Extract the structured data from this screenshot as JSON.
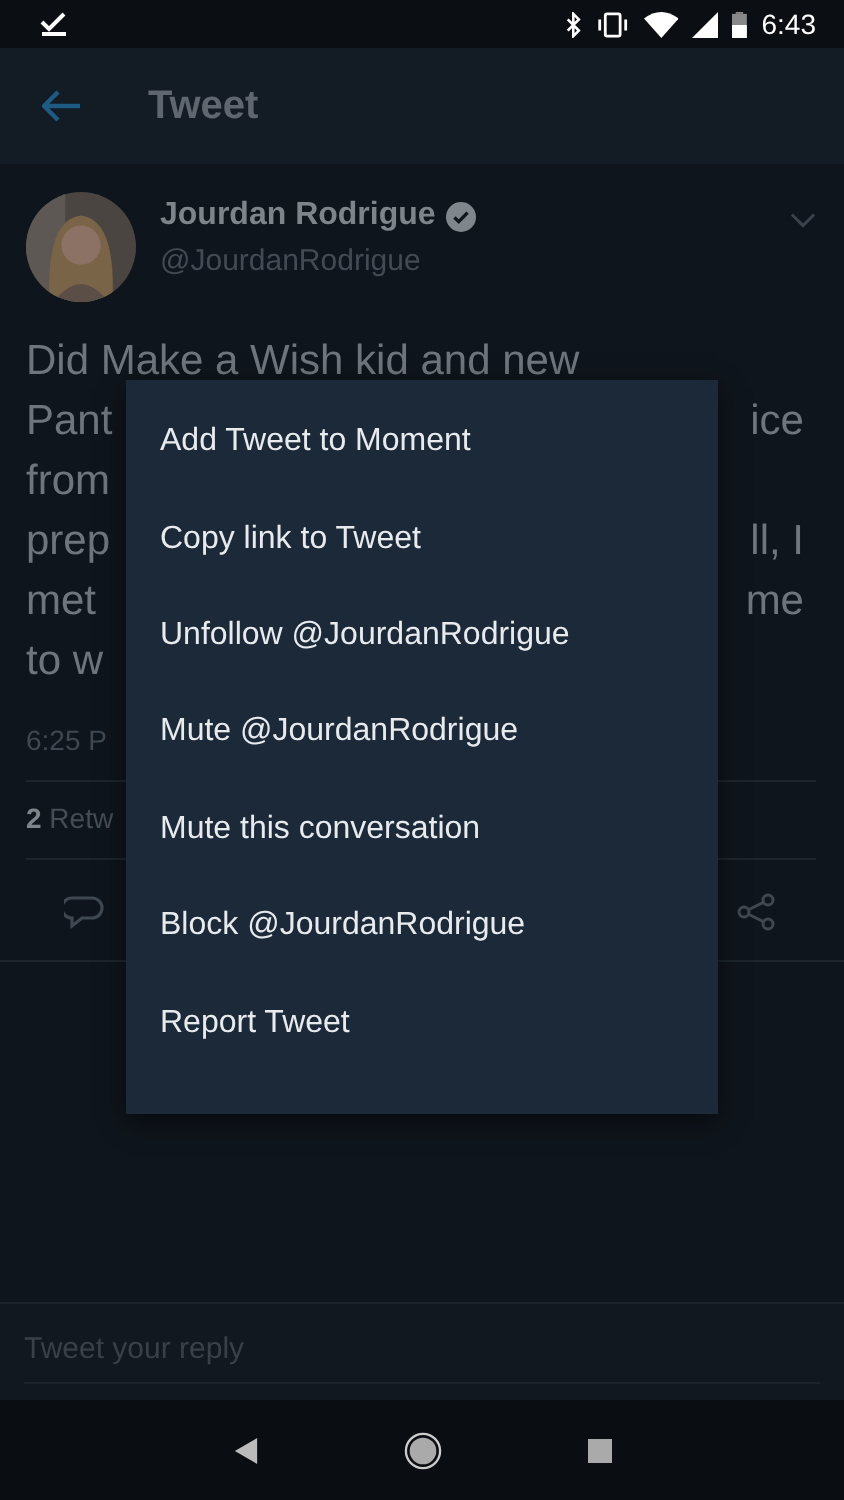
{
  "status_bar": {
    "time": "6:43"
  },
  "app_bar": {
    "title": "Tweet"
  },
  "tweet": {
    "author": {
      "name": "Jourdan Rodrigue",
      "handle": "@JourdanRodrigue",
      "verified": true
    },
    "text_lines": [
      {
        "left": "Did Make a Wish kid and new"
      },
      {
        "left": "Pant",
        "right": "ice"
      },
      {
        "left": "from"
      },
      {
        "left": "prep",
        "right": "ll, I"
      },
      {
        "left": "met",
        "right": "me"
      },
      {
        "left": "to w"
      }
    ],
    "timestamp": "6:25 P",
    "stats": {
      "count": "2",
      "label": "Retw"
    }
  },
  "menu": {
    "items": [
      "Add Tweet to Moment",
      "Copy link to Tweet",
      "Unfollow @JourdanRodrigue",
      "Mute @JourdanRodrigue",
      "Mute this conversation",
      "Block @JourdanRodrigue",
      "Report Tweet"
    ]
  },
  "reply": {
    "placeholder": "Tweet your reply"
  }
}
